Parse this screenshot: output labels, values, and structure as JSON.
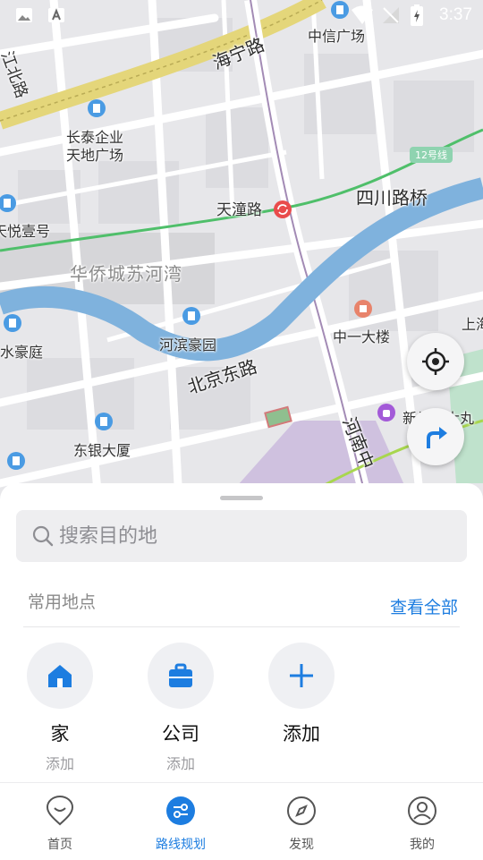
{
  "status_bar": {
    "time": "3:37"
  },
  "map": {
    "roads": {
      "haining": "海宁路",
      "sichuan": "四川路桥",
      "tiantong": "天潼路",
      "beijing_east": "北京东路",
      "henan": "河南中",
      "jiang_bei": "江北路"
    },
    "district": "华侨城苏河湾",
    "metro_badge": "12号线",
    "pois": {
      "zhongxin": "中信广场",
      "changtai_1": "长泰企业",
      "changtai_2": "天地广场",
      "tianyue": "天悦壹号",
      "hebin": "河滨豪园",
      "zhongyi": "中一大楼",
      "shuihao": "水豪庭",
      "dongyin": "东银大厦",
      "xinshijie": "新世界大丸",
      "shanghai_edge": "上海"
    }
  },
  "sheet": {
    "search": {
      "placeholder": "搜索目的地"
    },
    "section_title": "常用地点",
    "view_all": "查看全部",
    "places": [
      {
        "name": "家",
        "sub": "添加",
        "icon": "home-icon"
      },
      {
        "name": "公司",
        "sub": "添加",
        "icon": "briefcase-icon"
      },
      {
        "name": "添加",
        "sub": "",
        "icon": "plus-icon"
      }
    ]
  },
  "tabs": [
    {
      "label": "首页",
      "icon": "home-face-icon",
      "active": false
    },
    {
      "label": "路线规划",
      "icon": "route-icon",
      "active": true
    },
    {
      "label": "发现",
      "icon": "compass-icon",
      "active": false
    },
    {
      "label": "我的",
      "icon": "profile-icon",
      "active": false
    }
  ],
  "colors": {
    "accent": "#1d7de0",
    "river": "#7fb2dd",
    "highway": "#e8d980",
    "metro_line": "#4fbf6a"
  }
}
